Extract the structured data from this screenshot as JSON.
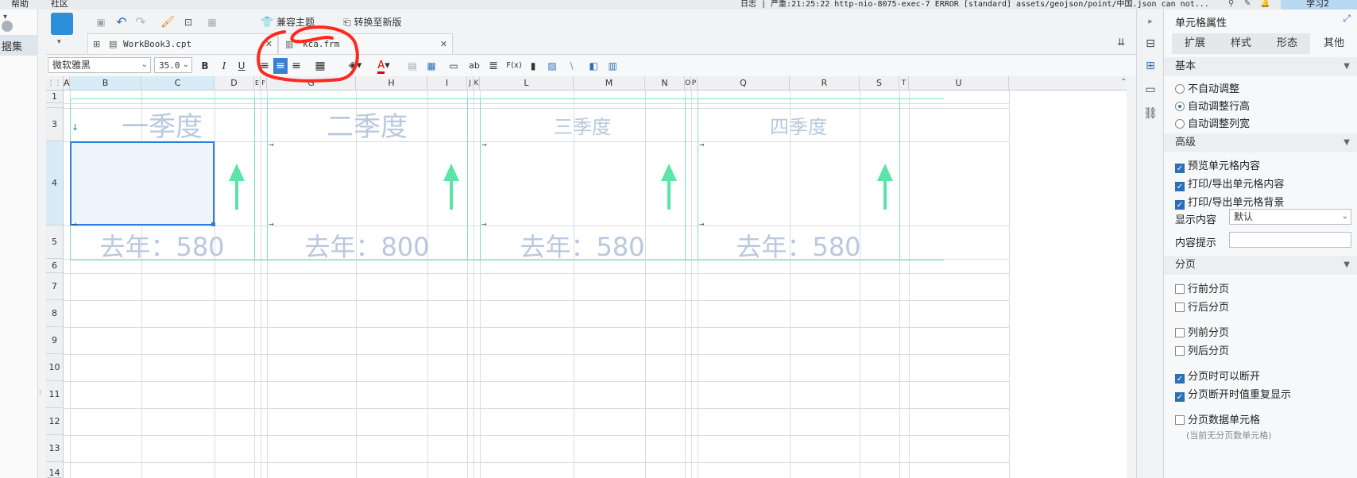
{
  "menubar": {
    "help": "帮助",
    "community": "社区",
    "log": "日志 | 严重:21:25:22 http-nio-8075-exec-7 ERROR [standard] assets/geojson/point/中国.json can not...",
    "learn": "学习2"
  },
  "left": {
    "datasets_label": "据集"
  },
  "toolbar": {
    "compat_theme": "兼容主题",
    "convert": "转换至新版"
  },
  "tabs": [
    {
      "label": "WorkBook3.cpt"
    },
    {
      "label": "kca.frm"
    }
  ],
  "format": {
    "font_family": "微软雅黑",
    "font_size": "35.0",
    "bold": "B",
    "italic": "I",
    "underline": "U",
    "ab": "ab",
    "fx": "F(x)"
  },
  "grid": {
    "columns": [
      "A",
      "B",
      "C",
      "D",
      "E",
      "F",
      "G",
      "H",
      "I",
      "J",
      "K",
      "L",
      "M",
      "N",
      "O",
      "P",
      "Q",
      "R",
      "S",
      "T",
      "U"
    ],
    "rows": [
      "1",
      "3",
      "4",
      "5",
      "6",
      "7",
      "8",
      "9",
      "10",
      "11",
      "12",
      "13",
      "14"
    ],
    "quarters": [
      {
        "title": "一季度",
        "last_year": "去年：580"
      },
      {
        "title": "二季度",
        "last_year": "去年：800"
      },
      {
        "title": "三季度",
        "last_year": "去年：580"
      },
      {
        "title": "四季度",
        "last_year": "去年：580"
      }
    ]
  },
  "panel": {
    "title": "单元格属性",
    "tabs": [
      "扩展",
      "样式",
      "形态",
      "其他"
    ],
    "active_tab": "其他",
    "basic": {
      "header": "基本",
      "options": [
        {
          "label": "不自动调整",
          "checked": false
        },
        {
          "label": "自动调整行高",
          "checked": true
        },
        {
          "label": "自动调整列宽",
          "checked": false
        }
      ]
    },
    "advanced": {
      "header": "高级",
      "checks": [
        {
          "label": "预览单元格内容",
          "checked": true
        },
        {
          "label": "打印/导出单元格内容",
          "checked": true
        },
        {
          "label": "打印/导出单元格背景",
          "checked": true
        }
      ],
      "display_label": "显示内容",
      "display_value": "默认",
      "tip_label": "内容提示",
      "tip_value": ""
    },
    "paging": {
      "header": "分页",
      "checks": [
        {
          "label": "行前分页",
          "checked": false
        },
        {
          "label": "行后分页",
          "checked": false
        },
        {
          "label": "列前分页",
          "checked": false
        },
        {
          "label": "列后分页",
          "checked": false
        },
        {
          "label": "分页时可以断开",
          "checked": true
        },
        {
          "label": "分页断开时值重复显示",
          "checked": true
        },
        {
          "label": "分页数据单元格",
          "checked": false
        }
      ],
      "note": "(当前无分页数单元格)"
    }
  },
  "colors": {
    "accent": "#2d6fb7",
    "arrow": "#5be3a9",
    "annotation": "#ff2a1f",
    "quarter_text": "#b9c8de"
  }
}
